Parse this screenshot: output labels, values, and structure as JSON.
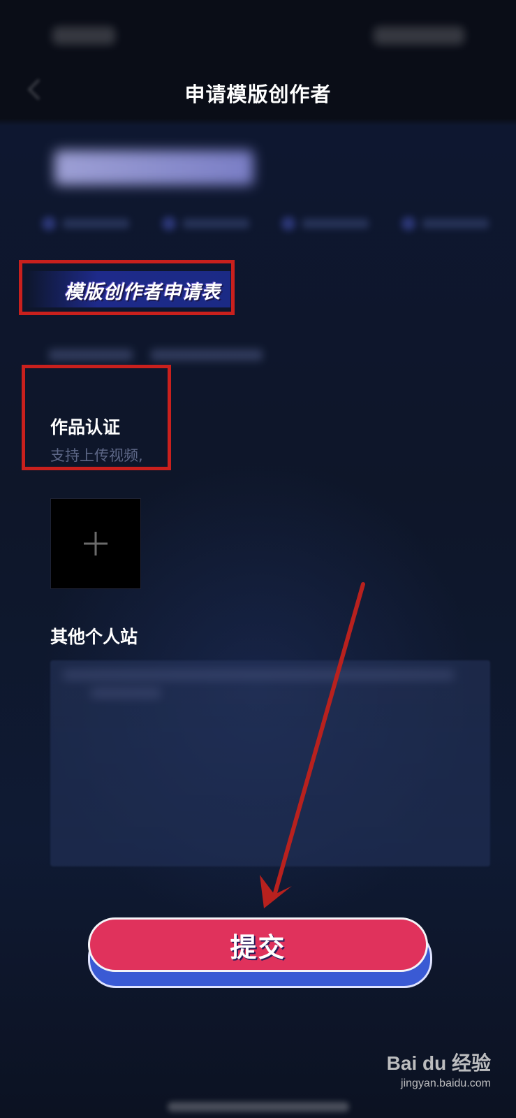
{
  "header": {
    "title": "申请模版创作者"
  },
  "section": {
    "title": "模版创作者申请表"
  },
  "works": {
    "label": "作品认证",
    "hint": "支持上传视频,"
  },
  "upload": {
    "icon": "plus-icon"
  },
  "other_sites": {
    "label": "其他个人站"
  },
  "actions": {
    "submit_label": "提交"
  },
  "watermark": {
    "brand": "Bai du 经验",
    "url": "jingyan.baidu.com"
  },
  "colors": {
    "submit": "#e0325c",
    "submit_shadow": "#3a5ad4",
    "highlight": "#c9201d",
    "background": "#0d1324"
  }
}
